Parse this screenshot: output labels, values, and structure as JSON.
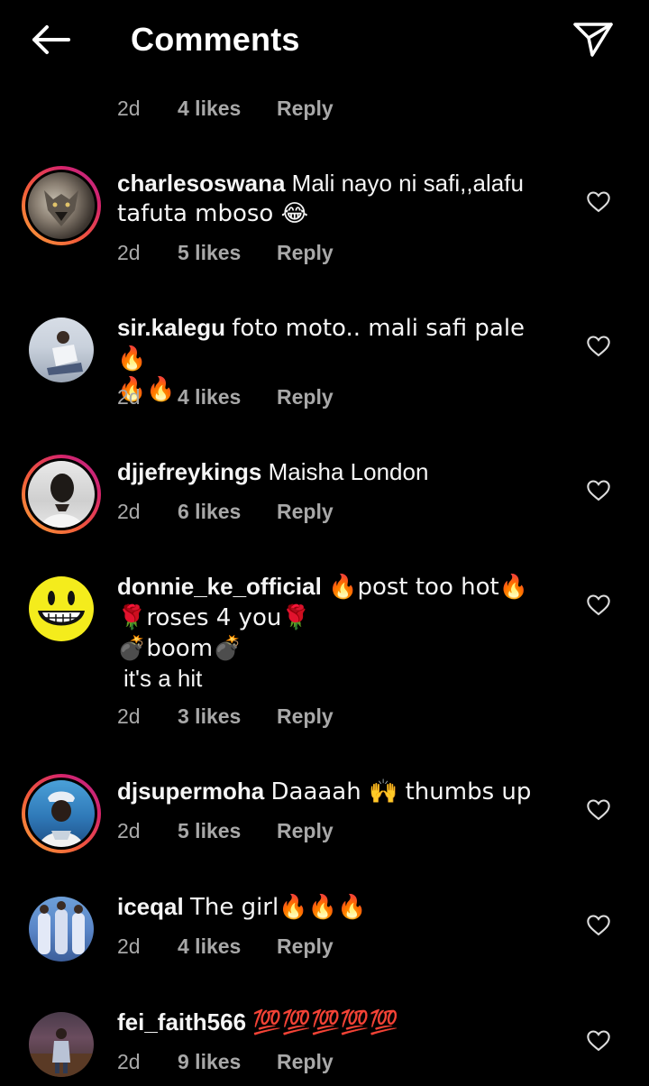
{
  "header": {
    "title": "Comments"
  },
  "top_meta": {
    "time": "2d",
    "likes": "4 likes",
    "reply": "Reply"
  },
  "comments": [
    {
      "username": "charlesoswana",
      "text_line1": "Mali nayo ni safi,,alafu",
      "text_line2": "tafuta mboso 😂",
      "time": "2d",
      "likes": "5 likes",
      "reply": "Reply",
      "story_ring": true
    },
    {
      "username": "sir.kalegu",
      "text_line1": "foto moto.. mali safi pale 🔥",
      "text_line2": "🔥🔥",
      "time": "2d",
      "likes": "4 likes",
      "reply": "Reply",
      "story_ring": false
    },
    {
      "username": "djjefreykings",
      "text_line1": "Maisha London",
      "time": "2d",
      "likes": "6 likes",
      "reply": "Reply",
      "story_ring": true
    },
    {
      "username": "donnie_ke_official",
      "text_line1": "🔥post too hot🔥",
      "text_line2": "🌹roses 4 you🌹",
      "text_line3": "💣boom💣",
      "text_line4": "it's a hit",
      "time": "2d",
      "likes": "3 likes",
      "reply": "Reply",
      "story_ring": false
    },
    {
      "username": "djsupermoha",
      "text_line1": "Daaaah 🙌 thumbs up",
      "time": "2d",
      "likes": "5 likes",
      "reply": "Reply",
      "story_ring": true
    },
    {
      "username": "iceqal",
      "text_line1": "The girl🔥🔥🔥",
      "time": "2d",
      "likes": "4 likes",
      "reply": "Reply",
      "story_ring": false
    },
    {
      "username": "fei_faith566",
      "text_line1": "💯💯💯💯💯",
      "time": "2d",
      "likes": "9 likes",
      "reply": "Reply",
      "story_ring": false
    }
  ],
  "icons": {
    "back": "arrow-left-icon",
    "share": "paper-plane-icon",
    "like": "heart-outline-icon"
  },
  "colors": {
    "background": "#000000",
    "text": "#ffffff",
    "meta": "#a8a8a8",
    "ring_start": "#f9a33a",
    "ring_end": "#b52a8c"
  }
}
